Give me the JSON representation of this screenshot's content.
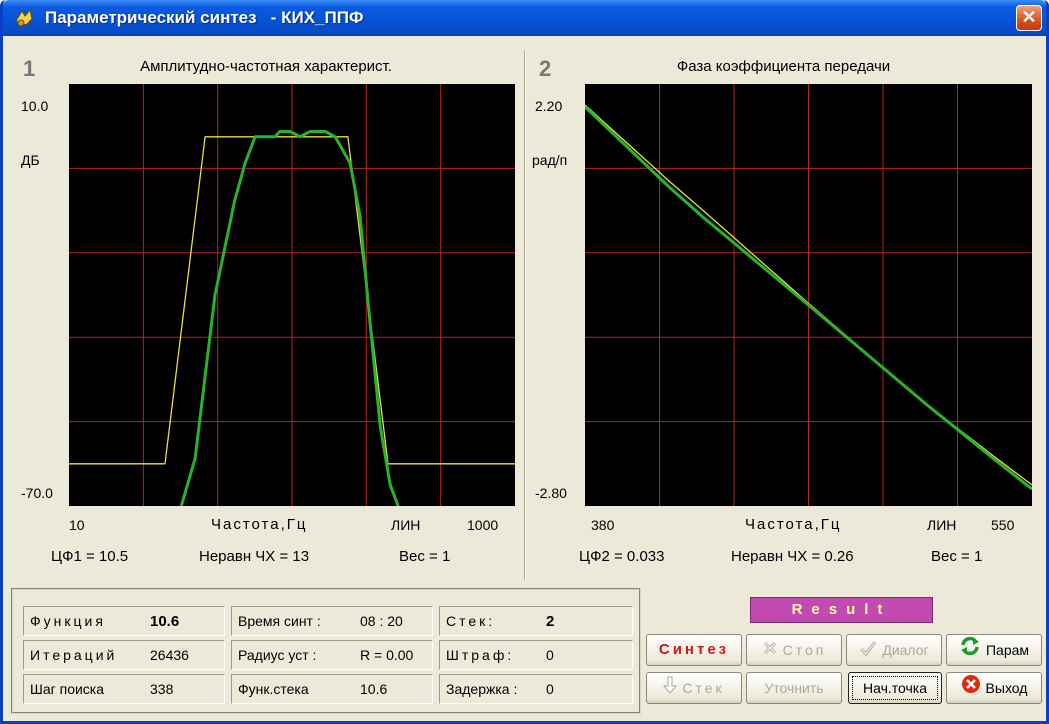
{
  "window": {
    "title": "Параметрический синтез   - КИХ_ППФ",
    "close_glyph": "✕"
  },
  "panel1": {
    "number": "1",
    "title": "Амплитудно-частотная характерист.",
    "y_top": "10.0",
    "y_unit": "ДБ",
    "y_bottom": "-70.0",
    "x_left": "10",
    "x_title": "Частота,Гц",
    "x_scale": "ЛИН",
    "x_right": "1000",
    "stat_cf": "ЦФ1 = 10.5",
    "stat_ner": "Неравн ЧХ = 13",
    "stat_ves": "Вес = 1"
  },
  "panel2": {
    "number": "2",
    "title": "Фаза коэффициента передачи",
    "y_top": "2.20",
    "y_unit": "рад/п",
    "y_bottom": "-2.80",
    "x_left": "380",
    "x_title": "Частота,Гц",
    "x_scale": "ЛИН",
    "x_right": "550",
    "stat_cf": "ЦФ2 =  0.033",
    "stat_ner": "Неравн ЧХ = 0.26",
    "stat_ves": "Вес = 1"
  },
  "info": {
    "func_label": "Функция",
    "func_value": "10.6",
    "iter_label": "Итераций",
    "iter_value": "26436",
    "step_label": "Шаг поиска",
    "step_value": "338",
    "time_label": "Время синт :",
    "time_value": "08 : 20",
    "radius_label": "Радиус уст :",
    "radius_value": "R = 0.00",
    "funcstack_label": "Функ.стека",
    "funcstack_value": "10.6",
    "stack_label": "Стек:",
    "stack_value": "2",
    "penalty_label": "Штраф:",
    "penalty_value": "0",
    "delay_label": "Задержка :",
    "delay_value": "0"
  },
  "result_label": "Result",
  "buttons": {
    "synth": "Синтез",
    "stop": "Стоп",
    "dialog": "Диалог",
    "param": "Парам",
    "stack": "Стек",
    "refine": "Уточнить",
    "startpoint": "Нач.точка",
    "exit": "Выход"
  },
  "colors": {
    "plot_bg": "#000000",
    "grid": "#b22222",
    "target": "#e8e040",
    "response": "#28b428"
  },
  "chart_data": [
    {
      "type": "line",
      "title": "Амплитудно-частотная характерист.",
      "xlabel": "Частота,Гц",
      "ylabel": "ДБ",
      "xlim": [
        10,
        1000
      ],
      "ylim": [
        -70,
        10
      ],
      "x_scale": "linear",
      "grid": true,
      "series": [
        {
          "x": [
            10,
            223,
            312,
            629,
            718,
            1000
          ],
          "values": [
            -62,
            -62,
            0,
            0,
            -62,
            -62
          ]
        },
        {
          "x": [
            10,
            85,
            109,
            124,
            145,
            167,
            178,
            200,
            223,
            256,
            290,
            334,
            378,
            401,
            423,
            445,
            467,
            478,
            489,
            501,
            523,
            545,
            579,
            601,
            634,
            656,
            678,
            701,
            723,
            745,
            767,
            790,
            812,
            1000
          ],
          "values": [
            -71,
            -71,
            -71,
            -71,
            -71,
            -71,
            -71,
            -71,
            -71,
            -71,
            -61,
            -30,
            -12,
            -5,
            0,
            0,
            0,
            1,
            1,
            1,
            0,
            1,
            1,
            0,
            -5,
            -15,
            -35,
            -55,
            -66,
            -71,
            -71,
            -71,
            -71,
            -71
          ]
        }
      ]
    },
    {
      "type": "line",
      "title": "Фаза коэффициента передачи",
      "xlabel": "Частота,Гц",
      "ylabel": "рад/п",
      "xlim": [
        380,
        550
      ],
      "ylim": [
        -2.8,
        2.2
      ],
      "x_scale": "linear",
      "grid": true,
      "series": [
        {
          "x": [
            380,
            412,
            425,
            465,
            510,
            535,
            550
          ],
          "values": [
            1.95,
            1.05,
            0.7,
            -0.4,
            -1.6,
            -2.2,
            -2.55
          ]
        },
        {
          "x": [
            380,
            412,
            425,
            465,
            510,
            535,
            550
          ],
          "values": [
            1.93,
            0.98,
            0.62,
            -0.42,
            -1.6,
            -2.23,
            -2.6
          ]
        }
      ]
    }
  ]
}
